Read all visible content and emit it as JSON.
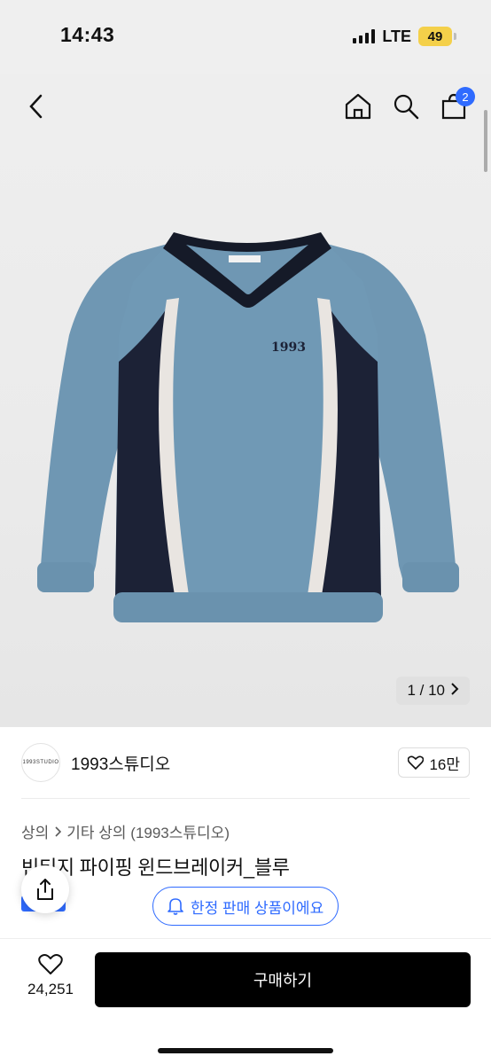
{
  "status_bar": {
    "time": "14:43",
    "network": "LTE",
    "battery": "49"
  },
  "nav": {
    "cart_count": "2"
  },
  "gallery": {
    "pager": "1 / 10"
  },
  "garment": {
    "logo_text": "1993"
  },
  "brand": {
    "logo_text": "1993STUDIO",
    "name": "1993스튜디오",
    "likes": "16만"
  },
  "breadcrumb": {
    "level1": "상의",
    "level2": "기타 상의 (1993스튜디오)"
  },
  "product": {
    "title": "빈티지 파이핑 윈드브레이커_블루",
    "limited_notice": "한정 판매 상품이에요"
  },
  "bottom_bar": {
    "wish_count": "24,251",
    "buy_label": "구매하기"
  },
  "colors": {
    "accent": "#2f6bff",
    "garment_blue": "#6f97b3",
    "garment_navy": "#1c2236",
    "buy_button": "#000000"
  },
  "icons": [
    "back-arrow-icon",
    "home-icon",
    "search-icon",
    "cart-icon",
    "chevron-right-icon",
    "heart-icon",
    "bell-icon",
    "share-icon"
  ]
}
